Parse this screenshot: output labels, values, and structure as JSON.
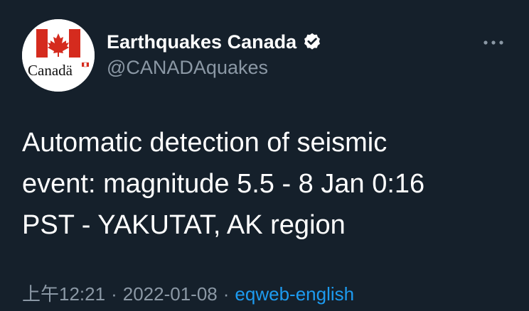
{
  "tweet": {
    "author": {
      "avatar_label": "Canadä",
      "display_name": "Earthquakes Canada",
      "verified_icon": "verified-badge-icon",
      "handle": "@CANADAquakes"
    },
    "menu_icon": "more-options-icon",
    "text": "Automatic detection of seismic\nevent: magnitude 5.5 - 8 Jan 0:16\nPST - YAKUTAT, AK region",
    "meta": {
      "time": "上午12:21",
      "separator": "·",
      "date": "2022-01-08",
      "source": "eqweb-english"
    }
  },
  "colors": {
    "background": "#15202b",
    "primary_text": "#ffffff",
    "secondary_text": "#8b98a5",
    "link": "#1d9bf0",
    "flag_red": "#d52b1e"
  }
}
